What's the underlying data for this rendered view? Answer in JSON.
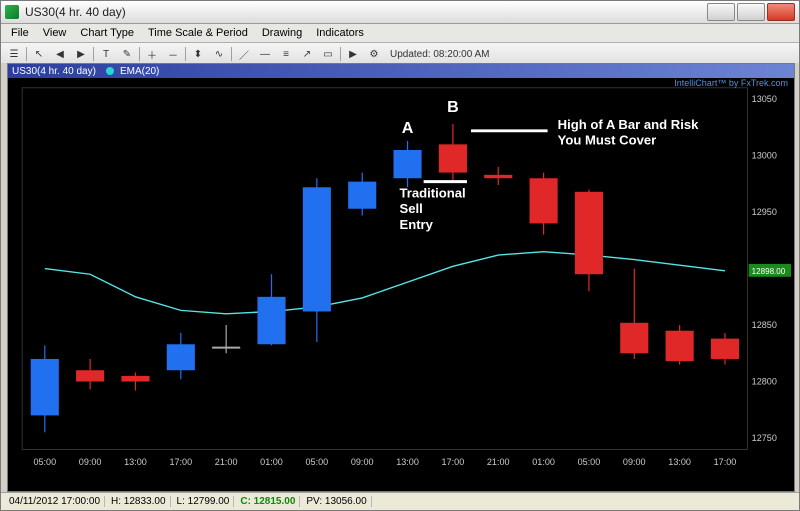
{
  "window": {
    "title": "US30(4 hr. 40 day)"
  },
  "menu": [
    "File",
    "View",
    "Chart Type",
    "Time Scale & Period",
    "Drawing",
    "Indicators"
  ],
  "toolbar": {
    "updated": "Updated: 08:20:00 AM",
    "buttons": [
      "open",
      "pointer",
      "back",
      "fwd",
      "text",
      "erase",
      "zoom-in",
      "zoom-out",
      "chart-candle",
      "chart-line",
      "line",
      "hline",
      "fib",
      "pitchfork",
      "arrow",
      "rect",
      "play",
      "settings"
    ]
  },
  "chartwin": {
    "symbol": "US30(4 hr. 40 day)",
    "indicator": "EMA(20)",
    "watermark_right": "IntelliChart™ by FxTrek.com"
  },
  "statusbar": {
    "datetime": "04/11/2012 17:00:00",
    "H": "H: 12833.00",
    "L": "L: 12799.00",
    "C": "C: 12815.00",
    "PV": "PV: 13056.00"
  },
  "yticks": [
    "13050",
    "13000",
    "12950",
    "12900",
    "12850",
    "12800",
    "12750"
  ],
  "xticks": [
    "05:00",
    "09:00",
    "13:00",
    "17:00",
    "21:00",
    "01:00",
    "05:00",
    "09:00",
    "13:00",
    "17:00",
    "21:00",
    "01:00",
    "05:00",
    "09:00",
    "13:00",
    "17:00"
  ],
  "price_tag": "12898.00",
  "annot": {
    "A": "A",
    "B": "B",
    "trad1": "Traditional",
    "trad2": "Sell",
    "trad3": "Entry",
    "high1": "High of A Bar and Risk",
    "high2": "You Must Cover"
  },
  "chart_data": {
    "type": "candlestick",
    "title": "US30(4 hr. 40 day)",
    "ylabel": "",
    "xlabel": "",
    "ylim": [
      12740,
      13060
    ],
    "overlay": {
      "name": "EMA(20)",
      "color": "#40e0d0"
    },
    "x_labels": [
      "05:00",
      "09:00",
      "13:00",
      "17:00",
      "21:00",
      "01:00",
      "05:00",
      "09:00",
      "13:00",
      "17:00",
      "21:00",
      "01:00",
      "05:00",
      "09:00",
      "13:00",
      "17:00"
    ],
    "ema_values": [
      12900,
      12895,
      12875,
      12863,
      12860,
      12862,
      12866,
      12874,
      12888,
      12902,
      12912,
      12915,
      12912,
      12908,
      12903,
      12898
    ],
    "candles": [
      {
        "x": "05:00",
        "open": 12820,
        "high": 12832,
        "low": 12755,
        "close": 12770,
        "color": "blue"
      },
      {
        "x": "09:00",
        "open": 12800,
        "high": 12820,
        "low": 12793,
        "close": 12810,
        "color": "red"
      },
      {
        "x": "13:00",
        "open": 12800,
        "high": 12808,
        "low": 12792,
        "close": 12805,
        "color": "red"
      },
      {
        "x": "17:00",
        "open": 12810,
        "high": 12843,
        "low": 12802,
        "close": 12833,
        "color": "blue"
      },
      {
        "x": "21:00",
        "open": 12828,
        "high": 12850,
        "low": 12825,
        "close": 12830,
        "color": null
      },
      {
        "x": "01:00",
        "open": 12833,
        "high": 12895,
        "low": 12832,
        "close": 12875,
        "color": "blue"
      },
      {
        "x": "05:00",
        "open": 12862,
        "high": 12980,
        "low": 12835,
        "close": 12972,
        "color": "blue"
      },
      {
        "x": "09:00",
        "open": 12977,
        "high": 12985,
        "low": 12947,
        "close": 12953,
        "color": "blue"
      },
      {
        "x": "13:00",
        "open": 12980,
        "high": 13013,
        "low": 12972,
        "close": 13005,
        "color": "blue"
      },
      {
        "x": "17:00",
        "open": 13010,
        "high": 13028,
        "low": 12977,
        "close": 12985,
        "color": "red"
      },
      {
        "x": "21:00",
        "open": 12983,
        "high": 12990,
        "low": 12974,
        "close": 12980,
        "color": "red"
      },
      {
        "x": "01:00",
        "open": 12980,
        "high": 12985,
        "low": 12930,
        "close": 12940,
        "color": "red"
      },
      {
        "x": "05:00",
        "open": 12968,
        "high": 12970,
        "low": 12880,
        "close": 12895,
        "color": "red"
      },
      {
        "x": "09:00",
        "open": 12852,
        "high": 12900,
        "low": 12820,
        "close": 12825,
        "color": "red"
      },
      {
        "x": "13:00",
        "open": 12845,
        "high": 12850,
        "low": 12815,
        "close": 12818,
        "color": "red"
      },
      {
        "x": "17:00",
        "open": 12838,
        "high": 12843,
        "low": 12815,
        "close": 12820,
        "color": "red"
      }
    ],
    "annotations": [
      {
        "label": "A",
        "target_x": "13:00",
        "target_bar_index": 8
      },
      {
        "label": "B",
        "target_x": "17:00",
        "target_bar_index": 9
      },
      {
        "text": "Traditional Sell Entry",
        "ref_bar_index": 9,
        "ref_price": 12977,
        "kind": "entry-line"
      },
      {
        "text": "High of A Bar and Risk You Must Cover",
        "ref_bar_index": 9,
        "ref_price": 13028,
        "kind": "risk-line"
      }
    ]
  }
}
